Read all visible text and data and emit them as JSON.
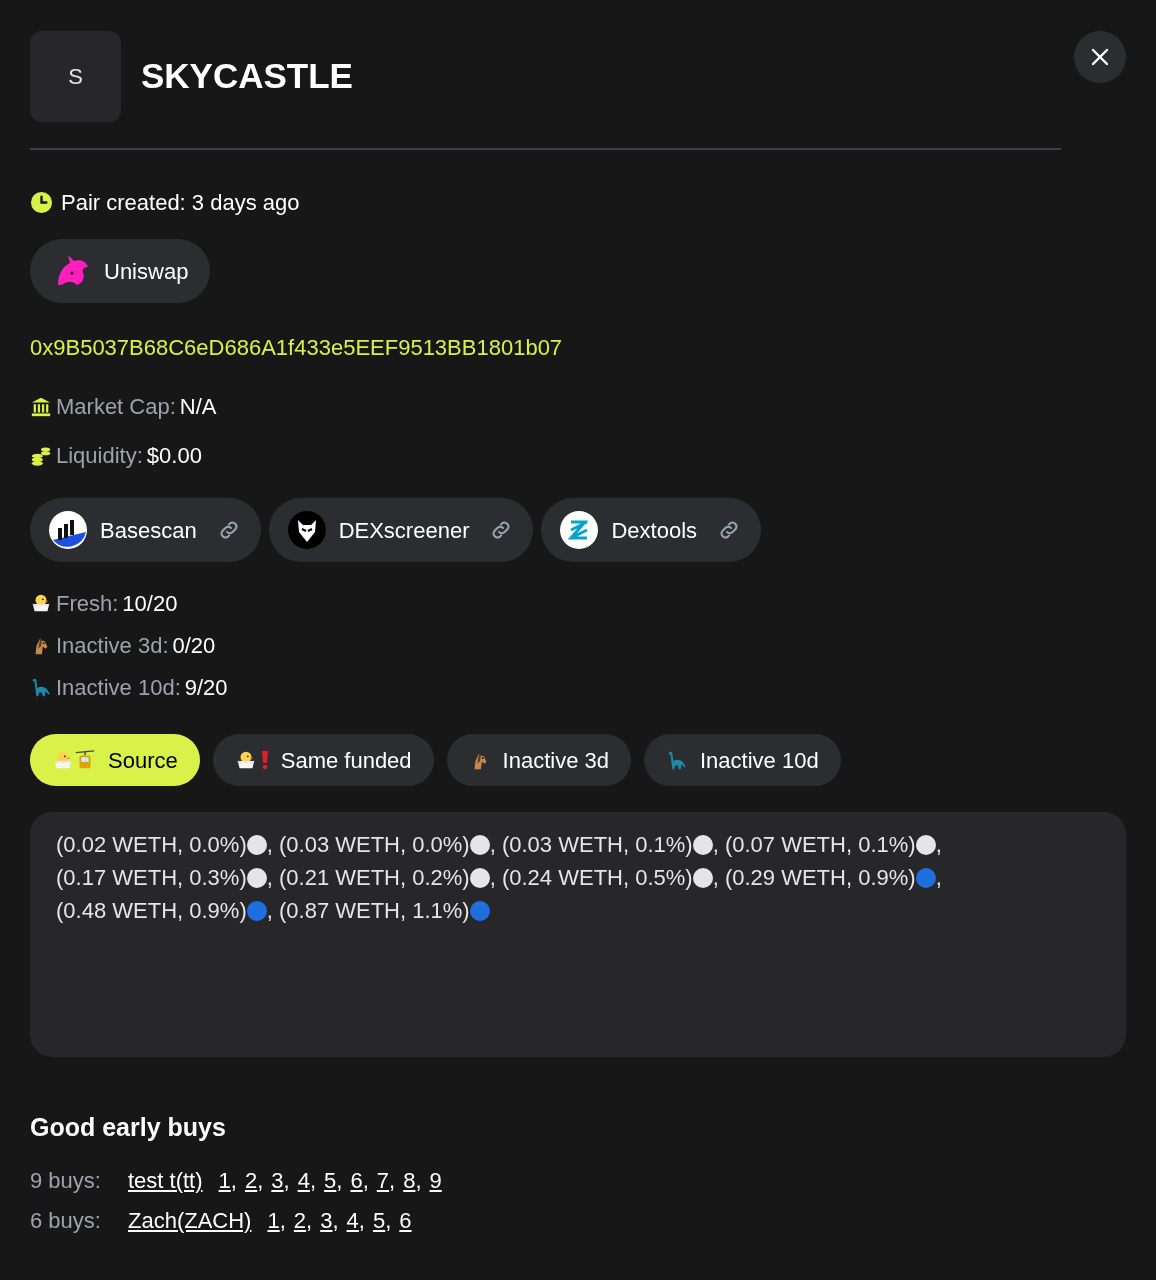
{
  "token": {
    "avatar_letter": "S",
    "name": "SKYCASTLE"
  },
  "pair_created": "Pair created: 3 days ago",
  "dex": {
    "label": "Uniswap"
  },
  "address": "0x9B5037B68C6eD686A1f433e5EEF9513BB1801b07",
  "metrics": [
    {
      "kind": "bank",
      "label": "Market Cap:",
      "value": "N/A"
    },
    {
      "kind": "coins",
      "label": "Liquidity:",
      "value": "$0.00"
    }
  ],
  "explorers": [
    {
      "kind": "basescan",
      "label": "Basescan"
    },
    {
      "kind": "dexscreener",
      "label": "DEXscreener"
    },
    {
      "kind": "dextools",
      "label": "Dextools"
    }
  ],
  "holder_stats": [
    {
      "kind": "chick",
      "label": "Fresh:",
      "value": "10/20"
    },
    {
      "kind": "horse",
      "label": "Inactive 3d:",
      "value": "0/20"
    },
    {
      "kind": "dino",
      "label": "Inactive 10d:",
      "value": "9/20"
    }
  ],
  "tabs": [
    {
      "kind": "source",
      "label": "Source",
      "selected": true
    },
    {
      "kind": "same",
      "label": "Same funded",
      "selected": false
    },
    {
      "kind": "horse",
      "label": "Inactive 3d",
      "selected": false
    },
    {
      "kind": "dino",
      "label": "Inactive 10d",
      "selected": false
    }
  ],
  "buys_list": [
    {
      "text": "(0.02 WETH, 0.0%)",
      "color": "#e5e5e5",
      "separator": ","
    },
    {
      "text": "(0.03 WETH, 0.0%)",
      "color": "#e5e5e5",
      "separator": ","
    },
    {
      "text": "(0.03 WETH, 0.1%)",
      "color": "#e5e5e5",
      "separator": ","
    },
    {
      "text": "(0.07 WETH, 0.1%)",
      "color": "#e5e5e5",
      "separator": ","
    },
    {
      "text": "(0.17 WETH, 0.3%)",
      "color": "#e5e5e5",
      "separator": ","
    },
    {
      "text": "(0.21 WETH, 0.2%)",
      "color": "#e5e5e5",
      "separator": ","
    },
    {
      "text": "(0.24 WETH, 0.5%)",
      "color": "#e5e5e5",
      "separator": ","
    },
    {
      "text": "(0.29 WETH, 0.9%)",
      "color": "#1d6fe0",
      "separator": ","
    },
    {
      "text": "(0.48 WETH, 0.9%)",
      "color": "#1d6fe0",
      "separator": ","
    },
    {
      "text": "(0.87 WETH, 1.1%)",
      "color": "#1d6fe0"
    }
  ],
  "good_early_buys": {
    "title": "Good early buys",
    "rows": [
      {
        "count": "9 buys:",
        "wallet": "test t(tt)",
        "links": [
          {
            "label": "1",
            "separator": ","
          },
          {
            "label": "2",
            "separator": ","
          },
          {
            "label": "3",
            "separator": ","
          },
          {
            "label": "4",
            "separator": ","
          },
          {
            "label": "5",
            "separator": ","
          },
          {
            "label": "6",
            "separator": ","
          },
          {
            "label": "7",
            "separator": ","
          },
          {
            "label": "8",
            "separator": ","
          },
          {
            "label": "9"
          }
        ]
      },
      {
        "count": "6 buys:",
        "wallet": "Zach(ZACH)",
        "links": [
          {
            "label": "1",
            "separator": ","
          },
          {
            "label": "2",
            "separator": ","
          },
          {
            "label": "3",
            "separator": ","
          },
          {
            "label": "4",
            "separator": ","
          },
          {
            "label": "5",
            "separator": ","
          },
          {
            "label": "6"
          }
        ]
      }
    ]
  }
}
